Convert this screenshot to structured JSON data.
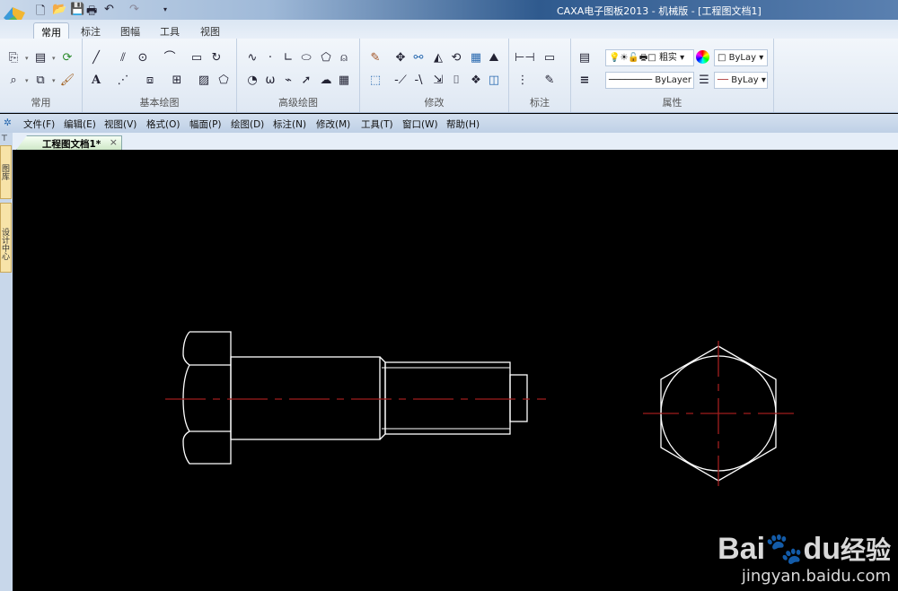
{
  "window": {
    "title": "CAXA电子图板2013 - 机械版 - [工程图文档1]"
  },
  "quick_access": [
    "new-icon",
    "open-icon",
    "save-icon",
    "print-icon",
    "undo-icon",
    "redo-icon"
  ],
  "ribbon_tabs": [
    "常用",
    "标注",
    "图幅",
    "工具",
    "视图"
  ],
  "ribbon_groups": [
    "常用",
    "基本绘图",
    "高级绘图",
    "修改",
    "标注",
    "属性"
  ],
  "properties": {
    "layer_combo": "粗实",
    "color_combo": "ByLay",
    "linetype_combo": "ByLayer",
    "lineweight_combo": "ByLay"
  },
  "menu": [
    "文件(F)",
    "编辑(E)",
    "视图(V)",
    "格式(O)",
    "幅面(P)",
    "绘图(D)",
    "标注(N)",
    "修改(M)",
    "工具(T)",
    "窗口(W)",
    "帮助(H)"
  ],
  "document_tab": {
    "label": "工程图文档1*",
    "close": "×"
  },
  "side_tabs": [
    "图库",
    "设计中心"
  ],
  "colors": {
    "canvas": "#000000",
    "geometry": "#ffffff",
    "centerline": "#a01e1e"
  },
  "watermark": {
    "brand_a": "Bai",
    "brand_b": "du",
    "brand_c": "经验",
    "url": "jingyan.baidu.com"
  }
}
